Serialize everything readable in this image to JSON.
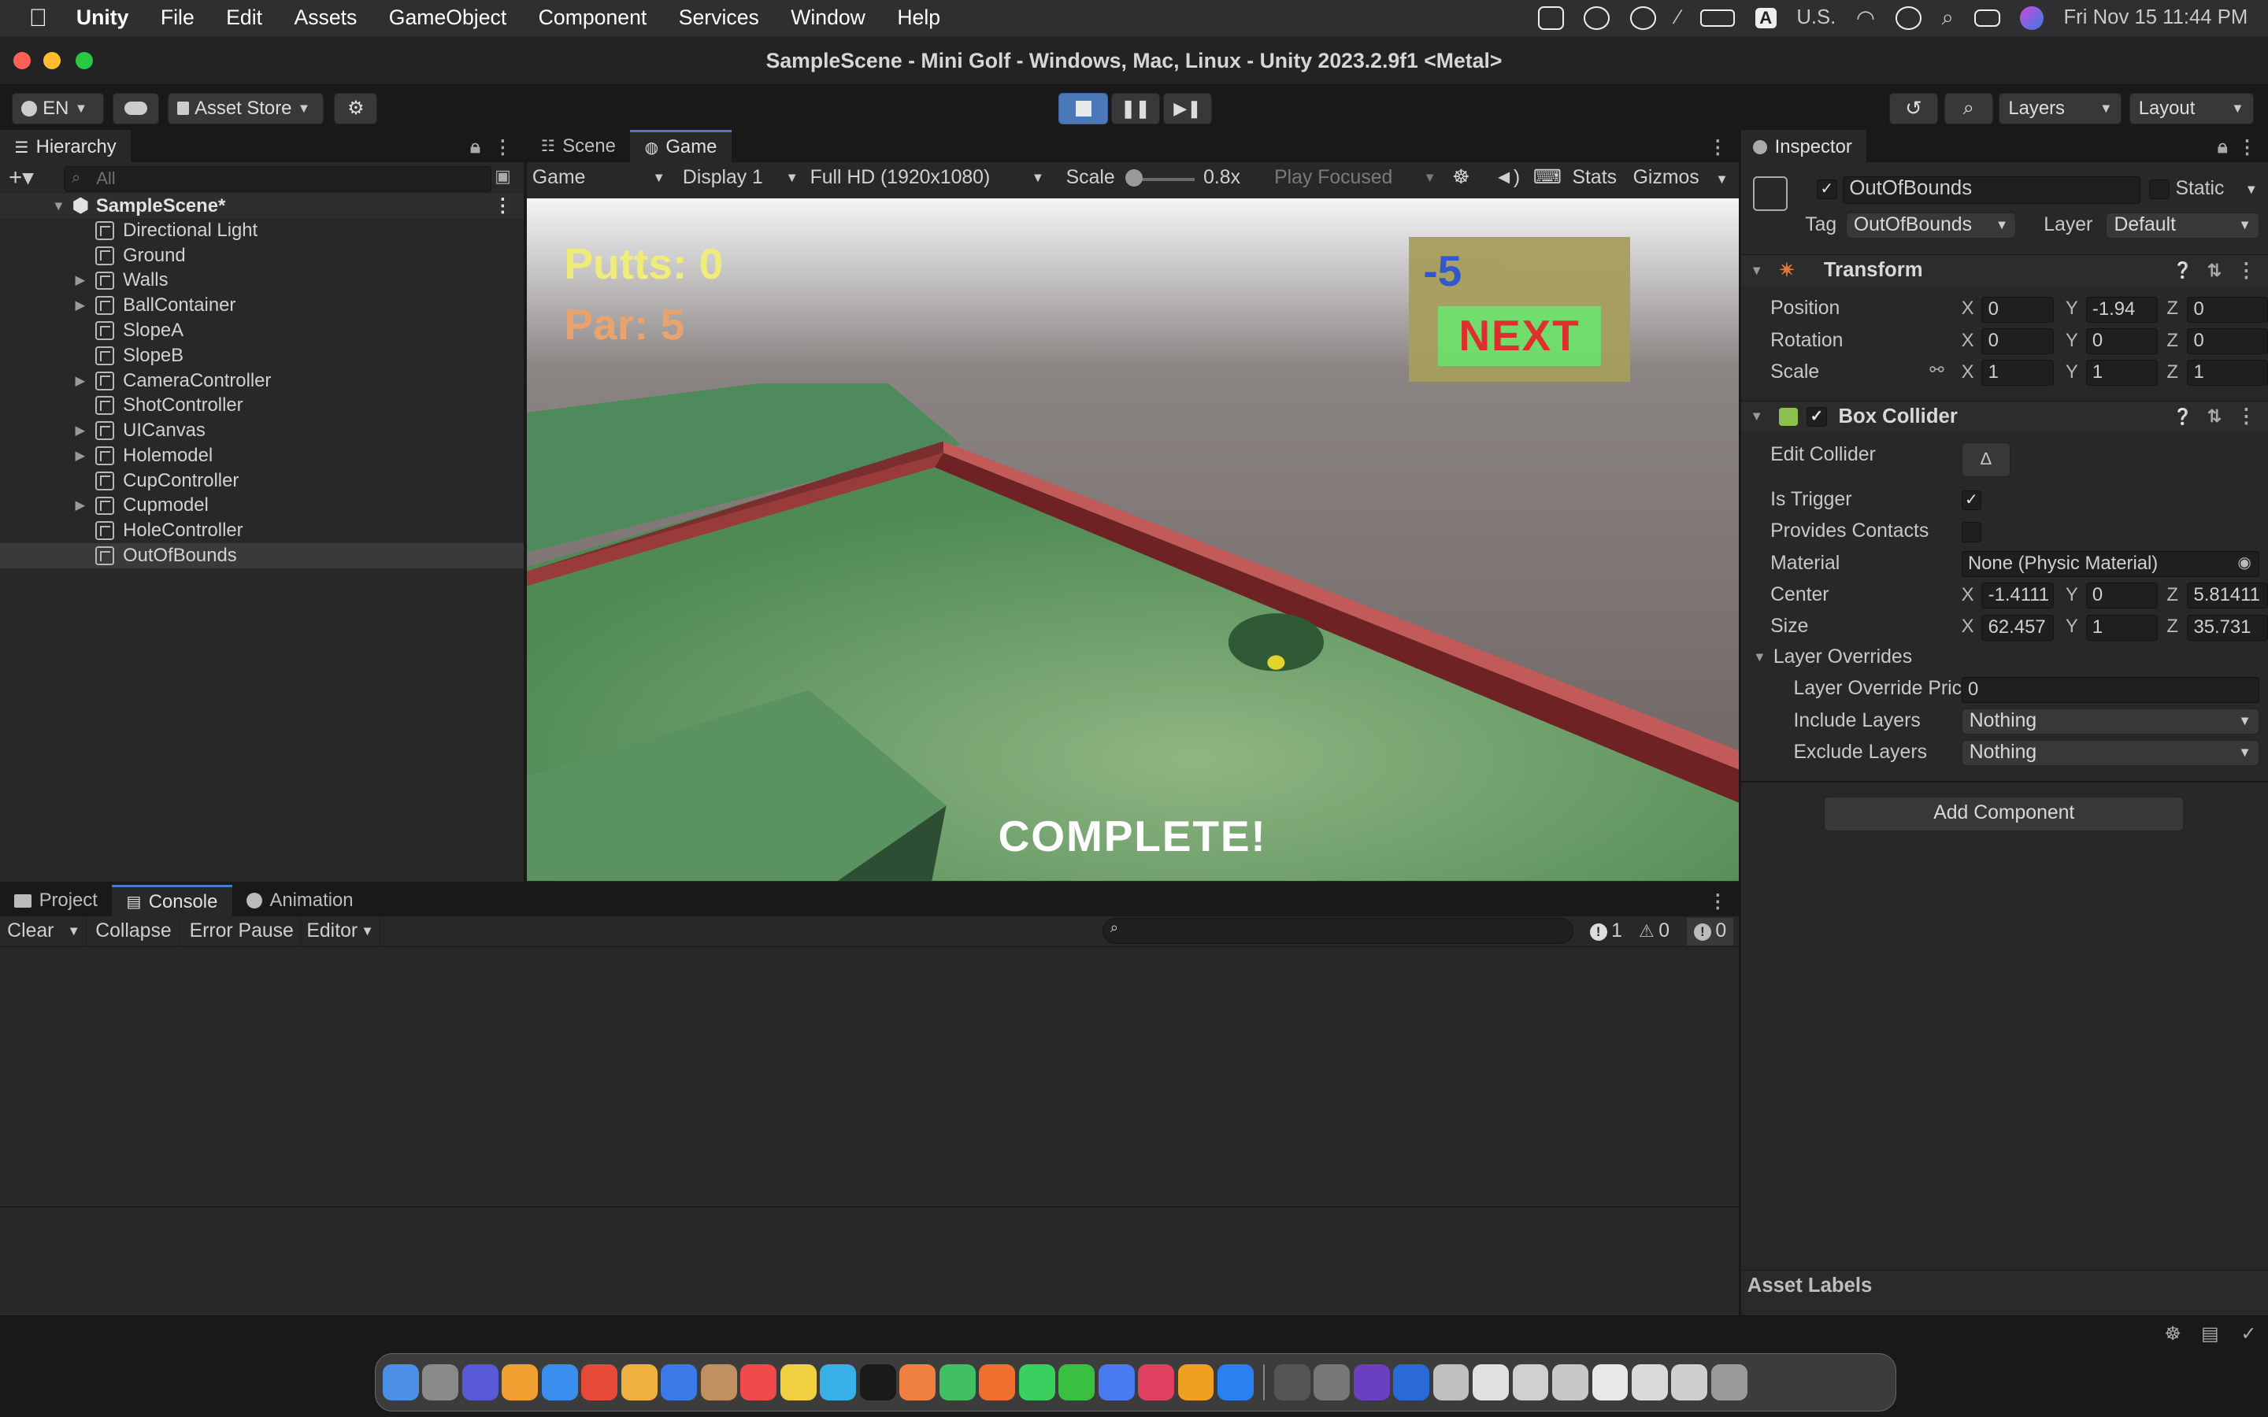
{
  "menubar": {
    "app": "Unity",
    "items": [
      "File",
      "Edit",
      "Assets",
      "GameObject",
      "Component",
      "Services",
      "Window",
      "Help"
    ],
    "input_source": "U.S.",
    "clock": "Fri Nov 15  11:44 PM"
  },
  "window": {
    "title": "SampleScene - Mini Golf - Windows, Mac, Linux - Unity 2023.2.9f1 <Metal>"
  },
  "toolbar": {
    "account": "EN",
    "asset_store": "Asset Store",
    "layers": "Layers",
    "layout": "Layout"
  },
  "hierarchy": {
    "tab": "Hierarchy",
    "search_placeholder": "All",
    "scene": "SampleScene*",
    "items": [
      {
        "label": "Directional Light",
        "expandable": false
      },
      {
        "label": "Ground",
        "expandable": false
      },
      {
        "label": "Walls",
        "expandable": true
      },
      {
        "label": "BallContainer",
        "expandable": true
      },
      {
        "label": "SlopeA",
        "expandable": false
      },
      {
        "label": "SlopeB",
        "expandable": false
      },
      {
        "label": "CameraController",
        "expandable": true
      },
      {
        "label": "ShotController",
        "expandable": false
      },
      {
        "label": "UICanvas",
        "expandable": true
      },
      {
        "label": "Holemodel",
        "expandable": true
      },
      {
        "label": "CupController",
        "expandable": false
      },
      {
        "label": "Cupmodel",
        "expandable": true
      },
      {
        "label": "HoleController",
        "expandable": false
      },
      {
        "label": "OutOfBounds",
        "expandable": false,
        "selected": true
      }
    ]
  },
  "gameview": {
    "tabs": [
      "Scene",
      "Game"
    ],
    "active_tab": "Game",
    "mode": "Game",
    "display": "Display 1",
    "resolution": "Full HD (1920x1080)",
    "scale_label": "Scale",
    "scale_value": "0.8x",
    "play_focused": "Play Focused",
    "stats": "Stats",
    "gizmos": "Gizmos",
    "hud": {
      "putts": "Putts: 0",
      "par": "Par: 5",
      "score": "-5",
      "next": "NEXT",
      "complete": "COMPLETE!"
    }
  },
  "inspector": {
    "tab": "Inspector",
    "object_name": "OutOfBounds",
    "static_label": "Static",
    "tag_label": "Tag",
    "tag_value": "OutOfBounds",
    "layer_label": "Layer",
    "layer_value": "Default",
    "transform": {
      "title": "Transform",
      "position": {
        "label": "Position",
        "x": "0",
        "y": "-1.94",
        "z": "0"
      },
      "rotation": {
        "label": "Rotation",
        "x": "0",
        "y": "0",
        "z": "0"
      },
      "scale": {
        "label": "Scale",
        "x": "1",
        "y": "1",
        "z": "1"
      }
    },
    "box_collider": {
      "title": "Box Collider",
      "edit_collider": "Edit Collider",
      "is_trigger": "Is Trigger",
      "is_trigger_checked": true,
      "provides_contacts": "Provides Contacts",
      "material_label": "Material",
      "material_value": "None (Physic Material)",
      "center": {
        "label": "Center",
        "x": "-1.4111",
        "y": "0",
        "z": "5.81411"
      },
      "size": {
        "label": "Size",
        "x": "62.457",
        "y": "1",
        "z": "35.731"
      },
      "layer_overrides": "Layer Overrides",
      "layer_override_priority_label": "Layer Override Pric",
      "layer_override_priority_value": "0",
      "include_layers_label": "Include Layers",
      "include_layers_value": "Nothing",
      "exclude_layers_label": "Exclude Layers",
      "exclude_layers_value": "Nothing"
    },
    "add_component": "Add Component",
    "asset_labels": "Asset Labels"
  },
  "console": {
    "tabs": [
      "Project",
      "Console",
      "Animation"
    ],
    "active_tab": "Console",
    "clear": "Clear",
    "collapse": "Collapse",
    "error_pause": "Error Pause",
    "editor": "Editor",
    "info_count": "1",
    "warn_count": "0",
    "error_count": "0"
  },
  "colors": {
    "accent": "#4a7ec4",
    "panel": "#282828",
    "selection": "#3a3a3a"
  }
}
